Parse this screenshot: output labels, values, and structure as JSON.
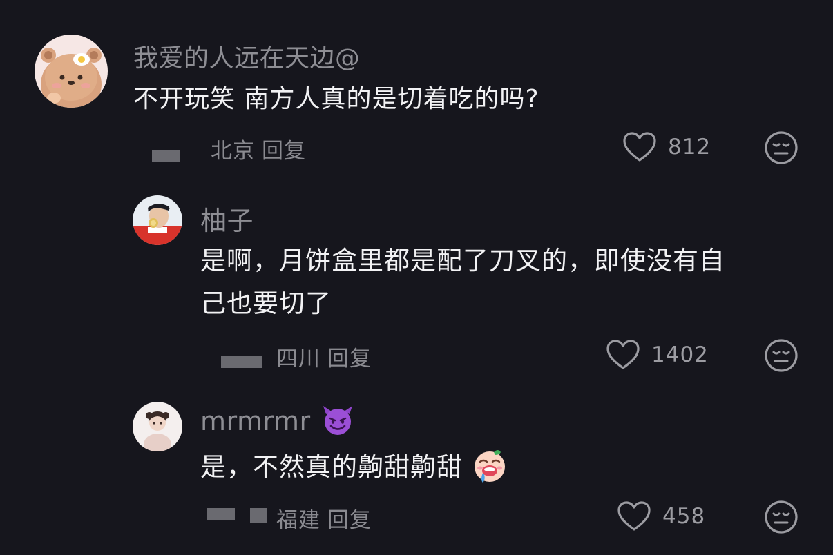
{
  "comments": [
    {
      "username": "我爱的人远在天边@",
      "text": "不开玩笑 南方人真的是切着吃的吗?",
      "location": "北京",
      "reply_label": "回复",
      "likes": "812",
      "avatar_icon": "bear-avatar-icon"
    },
    {
      "username": "柚子",
      "text_line1": "是啊，月饼盒里都是配了刀叉的，即使没有自",
      "text_line2": "己也要切了",
      "location": "四川",
      "reply_label": "回复",
      "likes": "1402",
      "avatar_icon": "athlete-avatar-icon"
    },
    {
      "username": "mrmrmr",
      "username_emoji": "smiling-devil-emoji",
      "text": "是，不然真的齁甜齁甜",
      "text_emoji": "drooling-face-emoji",
      "location": "福建",
      "reply_label": "回复",
      "likes": "458",
      "avatar_icon": "girl-avatar-icon"
    }
  ],
  "colors": {
    "background": "#16161d",
    "username": "#8e8e94",
    "content": "#f2f2f4",
    "meta": "#8a8a90"
  }
}
